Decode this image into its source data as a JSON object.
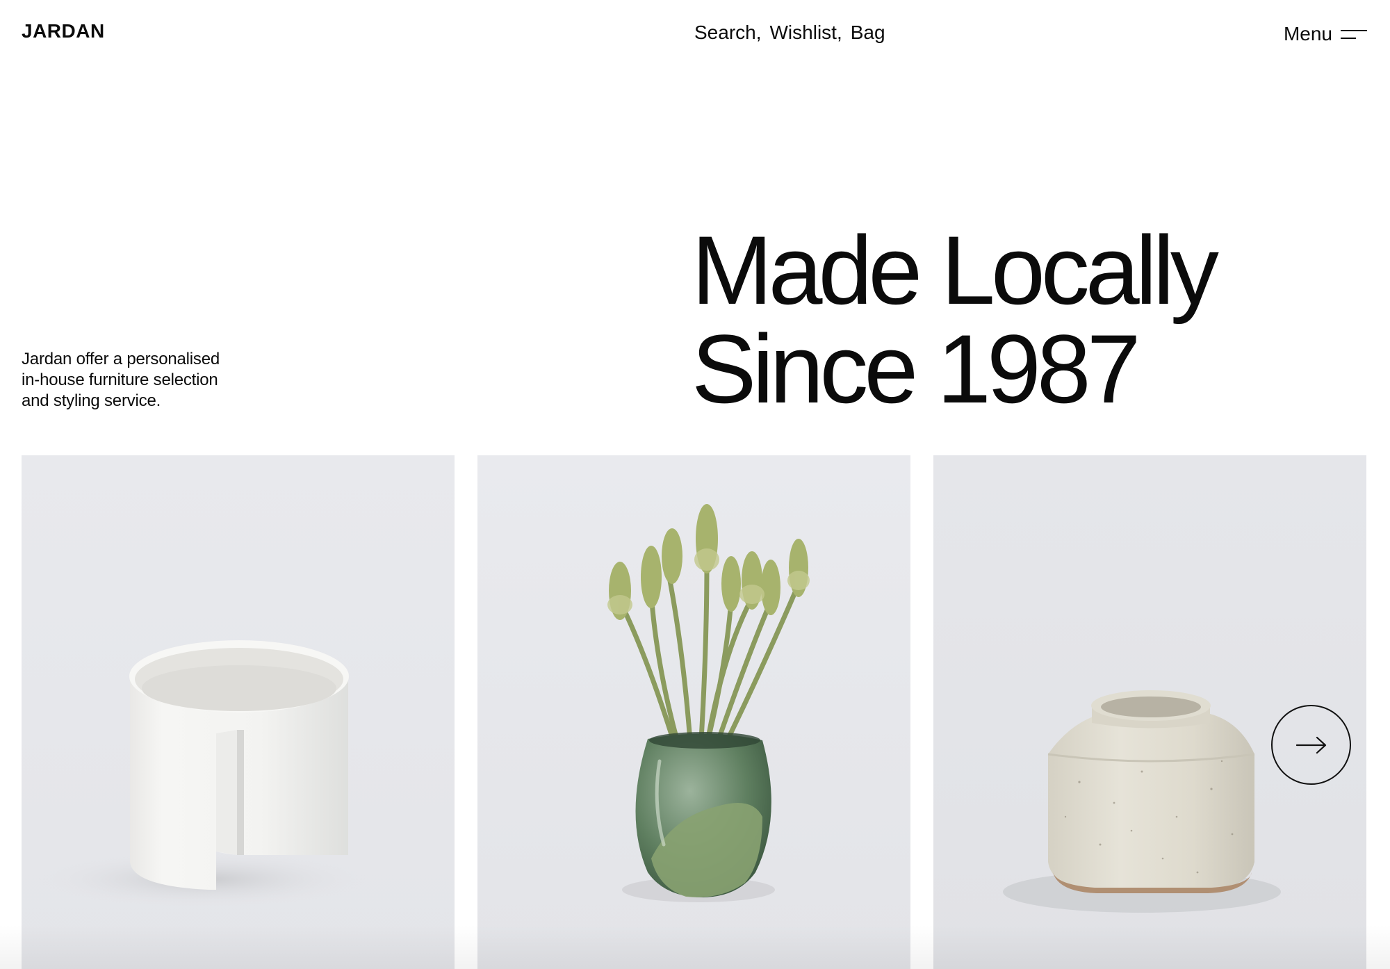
{
  "header": {
    "logo": "JARDAN",
    "nav": [
      {
        "label": "Search,"
      },
      {
        "label": "Wishlist,"
      },
      {
        "label": "Bag"
      }
    ],
    "menu_label": "Menu",
    "menu_icon": "hamburger-icon"
  },
  "hero": {
    "intro_lines": [
      "Jardan offer a personalised",
      "in-house furniture selection",
      "and styling service."
    ],
    "headline_lines": [
      "Made Locally",
      "Since 1987"
    ]
  },
  "products": [
    {
      "image": "white-ceramic-cylinder-planter"
    },
    {
      "image": "green-glass-vase-with-flowers"
    },
    {
      "image": "speckled-stoneware-jar"
    }
  ],
  "carousel": {
    "next_icon": "arrow-right-icon"
  },
  "colors": {
    "text": "#0b0b0b",
    "background": "#ffffff",
    "card_background": "#e9eaee",
    "vase_green": "#6f8c64",
    "stem_green": "#8fa066",
    "stoneware": "#dcd8cc"
  }
}
